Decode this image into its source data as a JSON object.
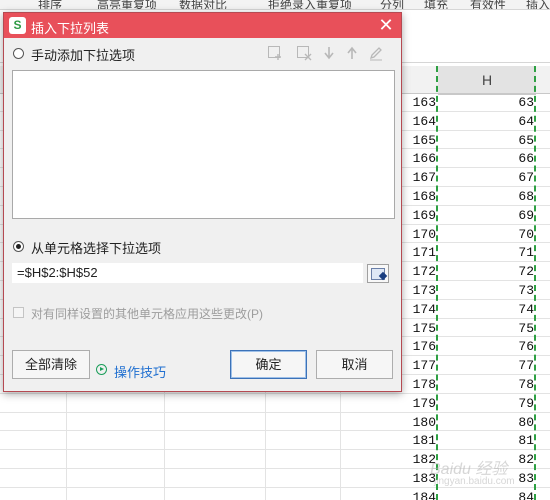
{
  "toolbar": {
    "items": [
      "排序",
      "高亮重复项",
      "数据对比",
      "拒绝录入重复项",
      "分列",
      "填充",
      "有效性",
      "插入"
    ]
  },
  "sheet": {
    "column_header": "H",
    "rows": [
      {
        "g": "163",
        "h": "63"
      },
      {
        "g": "164",
        "h": "64"
      },
      {
        "g": "165",
        "h": "65"
      },
      {
        "g": "166",
        "h": "66"
      },
      {
        "g": "167",
        "h": "67"
      },
      {
        "g": "168",
        "h": "68"
      },
      {
        "g": "169",
        "h": "69"
      },
      {
        "g": "170",
        "h": "70"
      },
      {
        "g": "171",
        "h": "71"
      },
      {
        "g": "172",
        "h": "72"
      },
      {
        "g": "173",
        "h": "73"
      },
      {
        "g": "174",
        "h": "74"
      },
      {
        "g": "175",
        "h": "75"
      },
      {
        "g": "176",
        "h": "76"
      },
      {
        "g": "177",
        "h": "77"
      },
      {
        "g": "178",
        "h": "78"
      },
      {
        "g": "179",
        "h": "79"
      },
      {
        "g": "180",
        "h": "80"
      },
      {
        "g": "181",
        "h": "81"
      },
      {
        "g": "182",
        "h": "82"
      },
      {
        "g": "183",
        "h": "83"
      },
      {
        "g": "184",
        "h": "84"
      },
      {
        "g": "185",
        "h": "85"
      }
    ]
  },
  "dialog": {
    "title": "插入下拉列表",
    "app_logo": "S",
    "close_glyph": "✕",
    "manual_option_label": "手动添加下拉选项",
    "manual_option_checked": false,
    "cell_option_label": "从单元格选择下拉选项",
    "cell_option_checked": true,
    "range_value": "=$H$2:$H$52",
    "apply_all_label": "对有同样设置的其他单元格应用这些更改(P)",
    "apply_all_checked": false,
    "clear_all_label": "全部清除",
    "tips_label": "操作技巧",
    "ok_label": "确定",
    "cancel_label": "取消",
    "toolbar_icons": [
      "add-item-icon",
      "delete-item-icon",
      "move-down-icon",
      "move-up-icon",
      "edit-icon"
    ]
  },
  "colors": {
    "title_bar": "#e8505a",
    "dashed_border": "#2ea043",
    "link": "#1f6fd0"
  }
}
